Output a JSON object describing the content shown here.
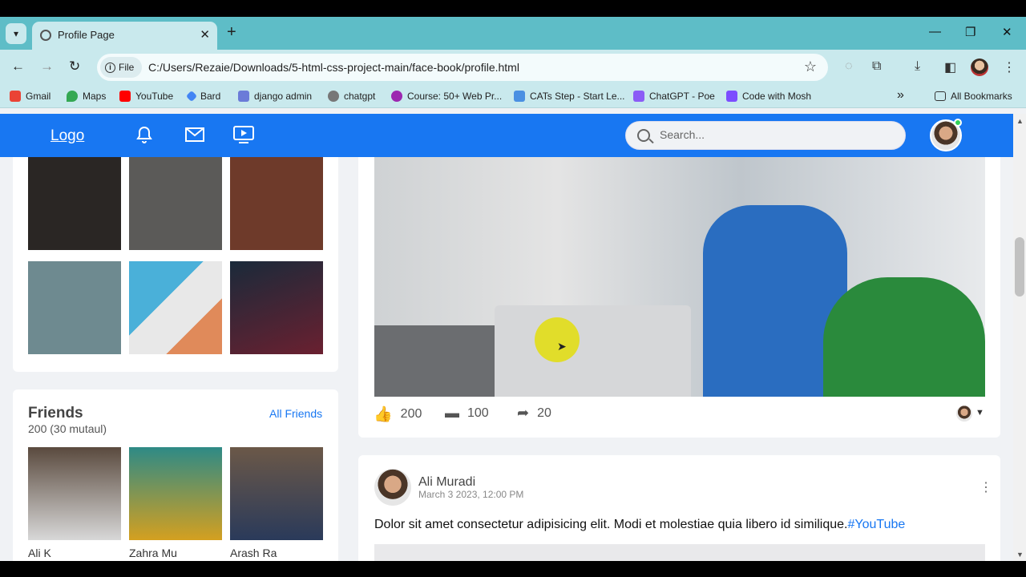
{
  "browser": {
    "tab_title": "Profile Page",
    "tab_close": "✕",
    "new_tab": "+",
    "url_scheme_label": "File",
    "url": "C:/Users/Rezaie/Downloads/5-html-css-project-main/face-book/profile.html",
    "window_controls": [
      "—",
      "❐",
      "✕"
    ],
    "bookmarks": [
      {
        "label": "Gmail",
        "icon": "gmail-icon",
        "color": "#ea4335"
      },
      {
        "label": "Maps",
        "icon": "maps-icon",
        "color": "#34a853"
      },
      {
        "label": "YouTube",
        "icon": "youtube-icon",
        "color": "#ff0000"
      },
      {
        "label": "Bard",
        "icon": "bard-icon",
        "color": "#4285f4"
      },
      {
        "label": "django admin",
        "icon": "django-icon",
        "color": "#6b7bd8"
      },
      {
        "label": "chatgpt",
        "icon": "chatgpt-icon",
        "color": "#777777"
      },
      {
        "label": "Course: 50+ Web Pr...",
        "icon": "course-icon",
        "color": "#9c27b0"
      },
      {
        "label": "CATs Step - Start Le...",
        "icon": "cats-icon",
        "color": "#4a90e2"
      },
      {
        "label": "ChatGPT - Poe",
        "icon": "poe-icon",
        "color": "#8b5cf6"
      },
      {
        "label": "Code with Mosh",
        "icon": "mosh-icon",
        "color": "#7c4dff"
      }
    ],
    "bookmarks_overflow": "»",
    "all_bookmarks": "All Bookmarks"
  },
  "navbar": {
    "logo": "Logo",
    "search_placeholder": "Search..."
  },
  "photos_section": {
    "photos": [
      {
        "alt": "man in red jacket reading newspaper",
        "color": "#2a2624"
      },
      {
        "alt": "man in red jacket outdoors",
        "color": "#5b5a58"
      },
      {
        "alt": "man in white sweater on bench",
        "color": "#6e3a2a"
      },
      {
        "alt": "man in leather jacket by building",
        "color": "#6e8a90"
      },
      {
        "alt": "man against colorful wall",
        "color": "#d98c5a"
      },
      {
        "alt": "man under neon light",
        "color": "#2b1f3a"
      }
    ]
  },
  "friends_section": {
    "title": "Friends",
    "count": "200 (30 mutaul)",
    "all_link": "All Friends",
    "friends": [
      {
        "name": "Ali K",
        "color": "#5a4a3e"
      },
      {
        "name": "Zahra Mu",
        "color": "#2e8a86"
      },
      {
        "name": "Arash Ra",
        "color": "#6b5848"
      }
    ]
  },
  "post1": {
    "likes": "200",
    "comments": "100",
    "shares": "20"
  },
  "post2": {
    "author": "Ali Muradi",
    "time": "March 3 2023, 12:00 PM",
    "text": "Dolor sit amet consectetur adipisicing elit. Modi et molestiae quia libero id similique.",
    "hashtag": "#YouTube"
  },
  "colors": {
    "brand": "#1877f2",
    "tab_strip": "#5ebdc7",
    "toolbar": "#c9e9ed"
  }
}
